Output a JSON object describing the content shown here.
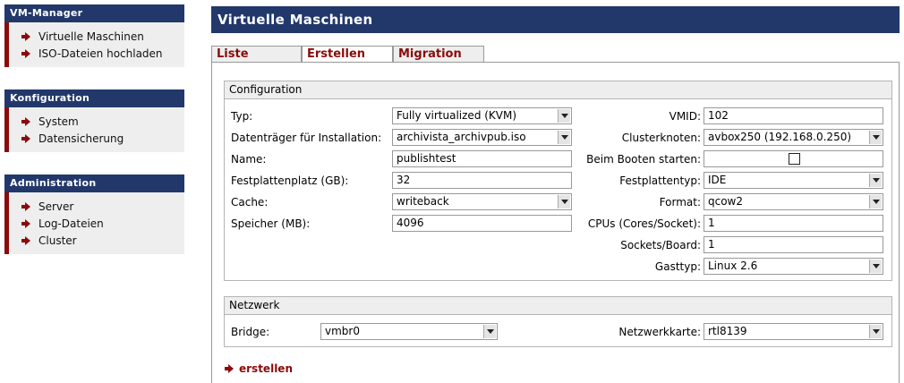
{
  "sidebar": [
    {
      "title": "VM-Manager",
      "items": [
        "Virtuelle Maschinen",
        "ISO-Dateien hochladen"
      ]
    },
    {
      "title": "Konfiguration",
      "items": [
        "System",
        "Datensicherung"
      ]
    },
    {
      "title": "Administration",
      "items": [
        "Server",
        "Log-Dateien",
        "Cluster"
      ]
    }
  ],
  "main": {
    "title": "Virtuelle Maschinen",
    "tabs": [
      "Liste",
      "Erstellen",
      "Migration"
    ],
    "active_tab": "Erstellen"
  },
  "configuration": {
    "title": "Configuration",
    "typ_label": "Typ:",
    "typ_value": "Fully virtualized (KVM)",
    "installation_label": "Datenträger für Installation:",
    "installation_value": "archivista_archivpub.iso",
    "name_label": "Name:",
    "name_value": "publishtest",
    "disk_label": "Festplattenplatz (GB):",
    "disk_value": "32",
    "cache_label": "Cache:",
    "cache_value": "writeback",
    "memory_label": "Speicher (MB):",
    "memory_value": "4096",
    "vmid_label": "VMID:",
    "vmid_value": "102",
    "cluster_label": "Clusterknoten:",
    "cluster_value": "avbox250 (192.168.0.250)",
    "boot_label": "Beim Booten starten:",
    "boot_checked": false,
    "disktype_label": "Festplattentyp:",
    "disktype_value": "IDE",
    "format_label": "Format:",
    "format_value": "qcow2",
    "cpus_label": "CPUs (Cores/Socket):",
    "cpus_value": "1",
    "sockets_label": "Sockets/Board:",
    "sockets_value": "1",
    "guest_label": "Gasttyp:",
    "guest_value": "Linux 2.6"
  },
  "network": {
    "title": "Netzwerk",
    "bridge_label": "Bridge:",
    "bridge_value": "vmbr0",
    "nic_label": "Netzwerkkarte:",
    "nic_value": "rtl8139"
  },
  "action_label": "erstellen",
  "colors": {
    "header_bg": "#22386b",
    "accent": "#8a0b0b",
    "panel_bg": "#eeeeee"
  }
}
